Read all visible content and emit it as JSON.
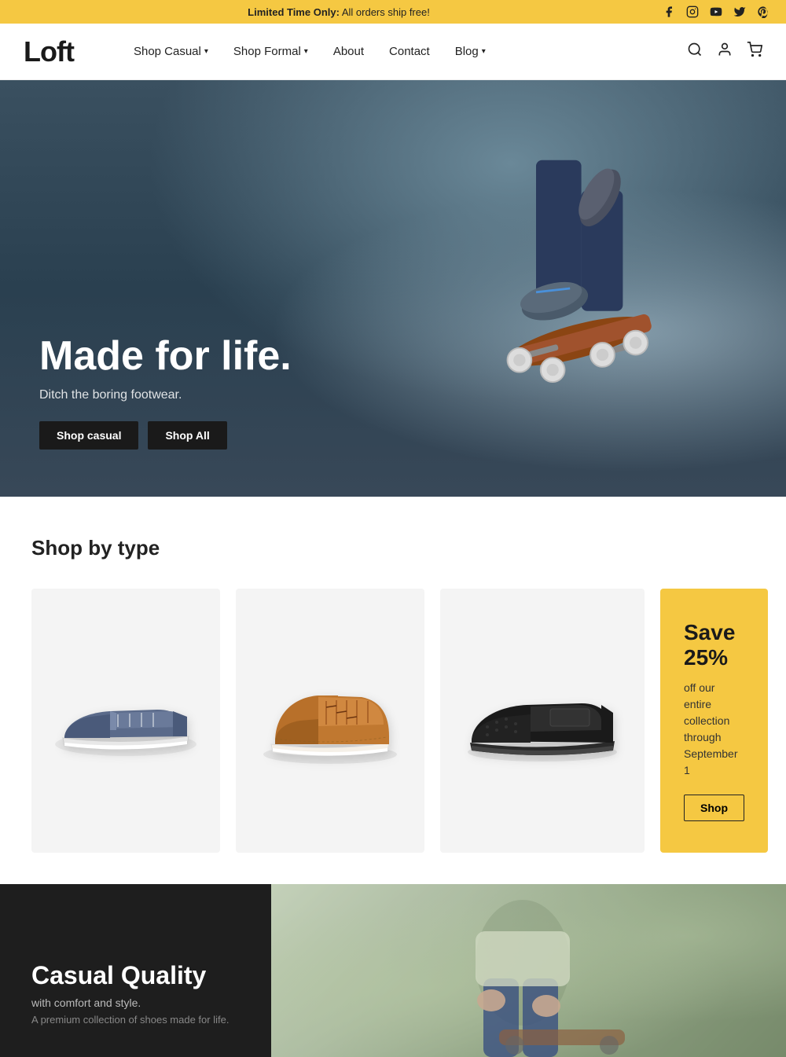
{
  "announcement": {
    "prefix": "Limited Time Only:",
    "message": " All orders ship free!"
  },
  "social": {
    "icons": [
      "facebook",
      "instagram",
      "youtube",
      "twitter",
      "pinterest"
    ]
  },
  "header": {
    "logo": "Loft",
    "nav": [
      {
        "label": "Shop Casual",
        "has_dropdown": true
      },
      {
        "label": "Shop Formal",
        "has_dropdown": true
      },
      {
        "label": "About",
        "has_dropdown": false
      },
      {
        "label": "Contact",
        "has_dropdown": false
      },
      {
        "label": "Blog",
        "has_dropdown": true
      }
    ]
  },
  "hero": {
    "title": "Made for life.",
    "subtitle": "Ditch the boring footwear.",
    "button_casual": "Shop casual",
    "button_all": "Shop All"
  },
  "shop_section": {
    "title": "Shop by type",
    "products": [
      {
        "type": "blue-sneaker",
        "color": "blue-grey"
      },
      {
        "type": "tan-boot",
        "color": "tan"
      },
      {
        "type": "black-loafer",
        "color": "black"
      }
    ],
    "promo": {
      "title": "Save 25%",
      "description": "off our entire collection through September 1",
      "button": "Shop"
    }
  },
  "bottom_section": {
    "title": "Casual Quality",
    "subtitle": "with comfort and style.",
    "description": "A premium collection of shoes made for life."
  }
}
